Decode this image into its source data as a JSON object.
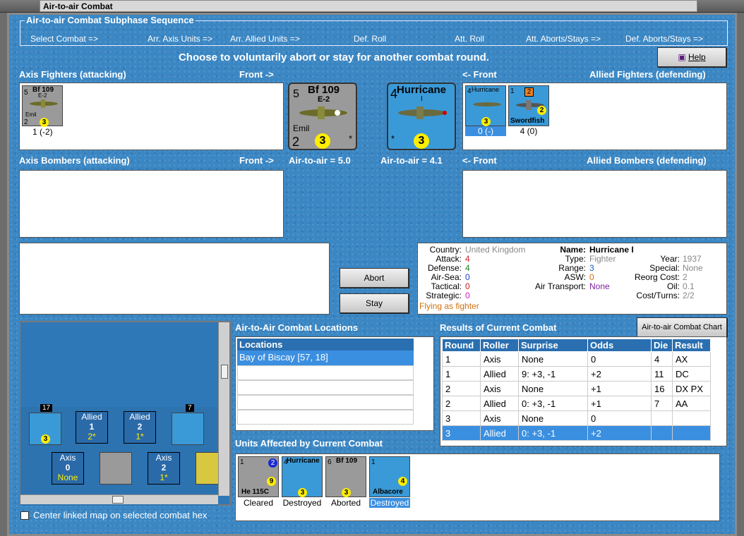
{
  "window_title": "Air-to-air Combat",
  "sequence": {
    "label": "Air-to-air Combat Subphase Sequence",
    "steps": [
      "Select Combat =>",
      "Arr. Axis Units =>",
      "Arr. Allied Units =>",
      "Def. Roll",
      "Att. Roll",
      "Att. Aborts/Stays =>",
      "Def. Aborts/Stays =>"
    ]
  },
  "instruction": "Choose to voluntarily abort or stay for another combat round.",
  "help_label": "Help",
  "axis_fighters": {
    "title": "Axis Fighters (attacking)",
    "front": "Front ->",
    "unit": {
      "attack": "5",
      "name": "Bf 109",
      "variant": "E-2",
      "pilot": "Emil",
      "defense": "2",
      "move": "3",
      "caption": "1 (-2)"
    }
  },
  "allied_fighters": {
    "title": "Allied Fighters (defending)",
    "front": "<- Front",
    "units": [
      {
        "attack": "4",
        "name": "Hurricane",
        "move": "3",
        "caption": "0 (-)"
      },
      {
        "attack": "1",
        "badge": "2",
        "name": "Swordfish",
        "move": "2",
        "caption": "4 (0)"
      }
    ]
  },
  "axis_large": {
    "attack": "5",
    "name": "Bf 109",
    "variant": "E-2",
    "pilot": "Emil",
    "defense": "2",
    "move": "3",
    "star": "*",
    "air_to_air": "Air-to-air = 5.0"
  },
  "allied_large": {
    "attack": "4",
    "name": "Hurricane",
    "variant": "I",
    "star": "*",
    "move": "3",
    "air_to_air": "Air-to-air = 4.1"
  },
  "axis_bombers": {
    "title": "Axis Bombers (attacking)",
    "front": "Front ->"
  },
  "allied_bombers": {
    "title": "Allied Bombers (defending)",
    "front": "<- Front"
  },
  "buttons": {
    "abort": "Abort",
    "stay": "Stay",
    "chart": "Air-to-air Combat Chart"
  },
  "unit_info": {
    "country_label": "Country:",
    "country": "United Kingdom",
    "attack_label": "Attack:",
    "attack": "4",
    "defense_label": "Defense:",
    "defense": "4",
    "airsea_label": "Air-Sea:",
    "airsea": "0",
    "tactical_label": "Tactical:",
    "tactical": "0",
    "strategic_label": "Strategic:",
    "strategic": "0",
    "flying": "Flying as fighter",
    "name_label": "Name:",
    "name": "Hurricane I",
    "type_label": "Type:",
    "type": "Fighter",
    "range_label": "Range:",
    "range": "3",
    "asw_label": "ASW:",
    "asw": "0",
    "transport_label": "Air Transport:",
    "transport": "None",
    "year_label": "Year:",
    "year": "1937",
    "special_label": "Special:",
    "special": "None",
    "reorg_label": "Reorg Cost:",
    "reorg": "2",
    "oil_label": "Oil:",
    "oil": "0.1",
    "cost_label": "Cost/Turns:",
    "cost": "2/2"
  },
  "map": {
    "stack_top_left": "17",
    "stack_top_right": "7",
    "allied_boxes": [
      {
        "label": "Allied",
        "value": "1",
        "sub": "2*"
      },
      {
        "label": "Allied",
        "value": "2",
        "sub": "1*"
      }
    ],
    "axis_boxes": [
      {
        "label": "Axis",
        "value": "0",
        "sub": "None"
      },
      {
        "label": "Axis",
        "value": "2",
        "sub": "1*"
      }
    ],
    "center_checkbox": "Center linked map on selected combat hex"
  },
  "locations": {
    "title": "Air-to-Air Combat Locations",
    "header": "Locations",
    "rows": [
      "Bay of Biscay [57, 18]"
    ]
  },
  "results": {
    "title": "Results of Current Combat",
    "headers": [
      "Round",
      "Roller",
      "Surprise",
      "Odds",
      "Die",
      "Result"
    ],
    "rows": [
      [
        "1",
        "Axis",
        "None",
        "0",
        "4",
        "AX"
      ],
      [
        "1",
        "Allied",
        "9: +3, -1",
        "+2",
        "11",
        "DC"
      ],
      [
        "2",
        "Axis",
        "None",
        "+1",
        "16",
        "DX PX"
      ],
      [
        "2",
        "Allied",
        "0: +3, -1",
        "+1",
        "7",
        "AA"
      ],
      [
        "3",
        "Axis",
        "None",
        "0",
        "",
        ""
      ],
      [
        "3",
        "Allied",
        "0: +3, -1",
        "+2",
        "",
        ""
      ]
    ]
  },
  "affected": {
    "title": "Units Affected by Current Combat",
    "units": [
      {
        "name": "He 115C",
        "status": "Cleared",
        "top": "1",
        "badge": "2",
        "val": "9"
      },
      {
        "name": "Hurricane",
        "status": "Destroyed",
        "top": "4",
        "val": "3"
      },
      {
        "name": "Bf 109",
        "status": "Aborted",
        "top": "6",
        "val": "3"
      },
      {
        "name": "Albacore",
        "status": "Destroyed",
        "top": "1",
        "val": "4"
      }
    ]
  },
  "colors": {
    "background": "#3b87c4",
    "header_blue": "#2a6fb0",
    "selection": "#3b8fe0",
    "counter_yellow": "#ffee00"
  }
}
